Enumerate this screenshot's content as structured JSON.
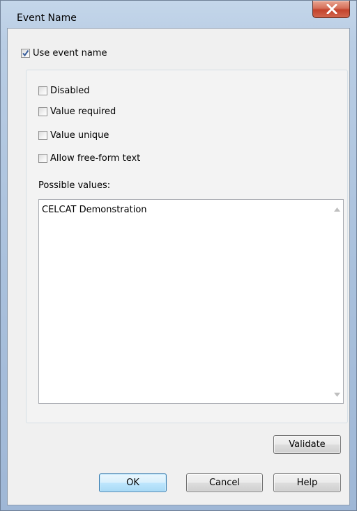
{
  "window": {
    "title": "Event Name"
  },
  "use_event_name": {
    "label": "Use event name",
    "checked": true
  },
  "options": [
    {
      "label": "Disabled",
      "checked": false
    },
    {
      "label": "Value required",
      "checked": false
    },
    {
      "label": "Value unique",
      "checked": false
    },
    {
      "label": "Allow free-form text",
      "checked": false
    }
  ],
  "possible_values": {
    "label": "Possible values:",
    "items": [
      "CELCAT Demonstration"
    ]
  },
  "buttons": {
    "validate": "Validate",
    "ok": "OK",
    "cancel": "Cancel",
    "help": "Help"
  },
  "colors": {
    "window_frame": "#b9cde4",
    "client_bg": "#f0f0f0",
    "close_button": "#c3432c",
    "checkmark": "#3a5f9c",
    "default_button_border": "#3c7fb1"
  },
  "icons": {
    "close": "close-icon",
    "check": "checkmark-icon",
    "scroll_up": "scroll-up-arrow-icon",
    "scroll_down": "scroll-down-arrow-icon"
  }
}
